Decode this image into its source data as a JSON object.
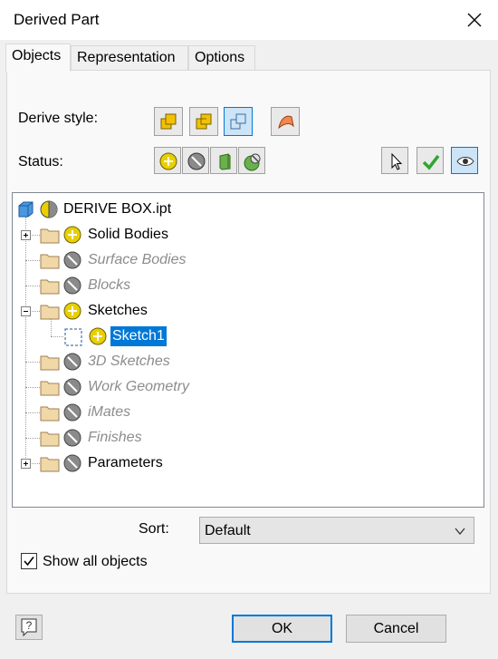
{
  "window": {
    "title": "Derived Part"
  },
  "tabs": [
    {
      "label": "Objects",
      "active": true
    },
    {
      "label": "Representation",
      "active": false
    },
    {
      "label": "Options",
      "active": false
    }
  ],
  "derive_style": {
    "label": "Derive style:",
    "buttons": [
      {
        "icon": "single-solid-merge-icon",
        "selected": false
      },
      {
        "icon": "single-solid-keep-seams-icon",
        "selected": false
      },
      {
        "icon": "multiple-solid-bodies-icon",
        "selected": true
      },
      {
        "icon": "surface-body-icon",
        "selected": false
      }
    ]
  },
  "status": {
    "label": "Status:",
    "buttons": [
      {
        "icon": "include-icon"
      },
      {
        "icon": "exclude-icon"
      },
      {
        "icon": "body-as-work-surface-icon"
      },
      {
        "icon": "mixed-status-icon"
      }
    ],
    "right_buttons": [
      {
        "icon": "select-cursor-icon"
      },
      {
        "icon": "check-icon"
      },
      {
        "icon": "eye-icon",
        "selected": true
      }
    ]
  },
  "tree": {
    "root": "DERIVE BOX.ipt",
    "items": [
      {
        "label": "Solid Bodies",
        "status": "include",
        "enabled": true,
        "expander": "+"
      },
      {
        "label": "Surface Bodies",
        "status": "exclude",
        "enabled": false
      },
      {
        "label": "Blocks",
        "status": "exclude",
        "enabled": false
      },
      {
        "label": "Sketches",
        "status": "include",
        "enabled": true,
        "expander": "-"
      },
      {
        "label": "Sketch1",
        "status": "include",
        "enabled": true,
        "selected": true,
        "child": true
      },
      {
        "label": "3D Sketches",
        "status": "exclude",
        "enabled": false
      },
      {
        "label": "Work Geometry",
        "status": "exclude",
        "enabled": false
      },
      {
        "label": "iMates",
        "status": "exclude",
        "enabled": false
      },
      {
        "label": "Finishes",
        "status": "exclude",
        "enabled": false
      },
      {
        "label": "Parameters",
        "status": "exclude",
        "enabled": true,
        "expander": "+"
      }
    ]
  },
  "sort": {
    "label": "Sort:",
    "value": "Default"
  },
  "show_all": {
    "label": "Show all objects",
    "checked": true
  },
  "buttons": {
    "ok": "OK",
    "cancel": "Cancel"
  },
  "colors": {
    "accent": "#0078d7",
    "selection": "#0078d7",
    "folder": "#f0d8a8"
  }
}
